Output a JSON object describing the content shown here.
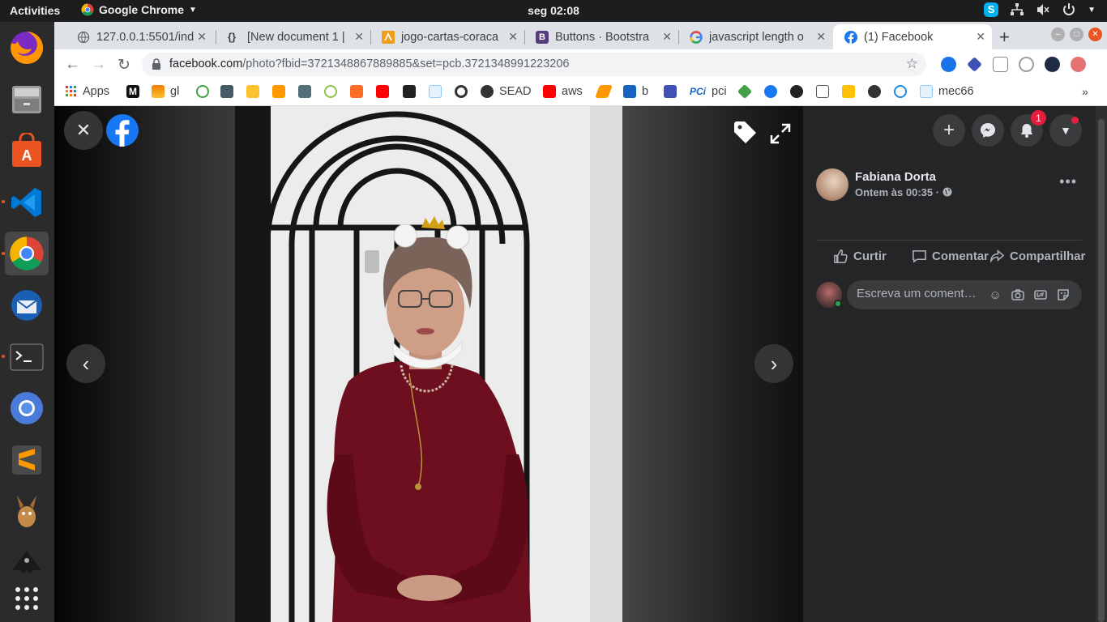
{
  "os_bar": {
    "activities": "Activities",
    "app_name": "Google Chrome",
    "clock": "seg 02:08"
  },
  "dock": {
    "items": [
      "firefox-icon",
      "file-manager-icon",
      "software-store-icon",
      "vscode-icon",
      "chrome-icon",
      "thunderbird-icon",
      "terminal-icon",
      "chromium-icon",
      "sublime-text-icon",
      "emule-icon",
      "inkscape-icon",
      "app-grid-icon"
    ]
  },
  "tabs": [
    {
      "title": "127.0.0.1:5501/ind",
      "favicon": "globe-icon"
    },
    {
      "title": "[New document 1 |",
      "favicon": "braces-icon"
    },
    {
      "title": "jogo-cartas-coraca",
      "favicon": "codepen-icon"
    },
    {
      "title": "Buttons · Bootstra",
      "favicon": "bootstrap-icon"
    },
    {
      "title": "javascript length o",
      "favicon": "google-icon"
    },
    {
      "title": "(1) Facebook",
      "favicon": "facebook-icon",
      "active": true
    }
  ],
  "toolbar": {
    "url_host": "facebook.com",
    "url_path": "/photo?fbid=3721348867889885&set=pcb.3721348991223206"
  },
  "bookmarks": [
    {
      "label": "Apps"
    },
    {
      "label": ""
    },
    {
      "label": "gl"
    },
    {
      "label": "SEAD"
    },
    {
      "label": "aws"
    },
    {
      "label": "b"
    },
    {
      "label": "pci"
    },
    {
      "label": "mec66"
    }
  ],
  "panel": {
    "notifications_count": "1",
    "author": "Fabiana Dorta",
    "timestamp": "Ontem às 00:35 ·",
    "actions": {
      "like": "Curtir",
      "comment": "Comentar",
      "share": "Compartilhar"
    },
    "comment_placeholder": "Escreva um coment…"
  },
  "colors": {
    "facebook_blue": "#1877f2",
    "panel_bg": "#242526",
    "ubuntu_orange": "#e95420"
  }
}
